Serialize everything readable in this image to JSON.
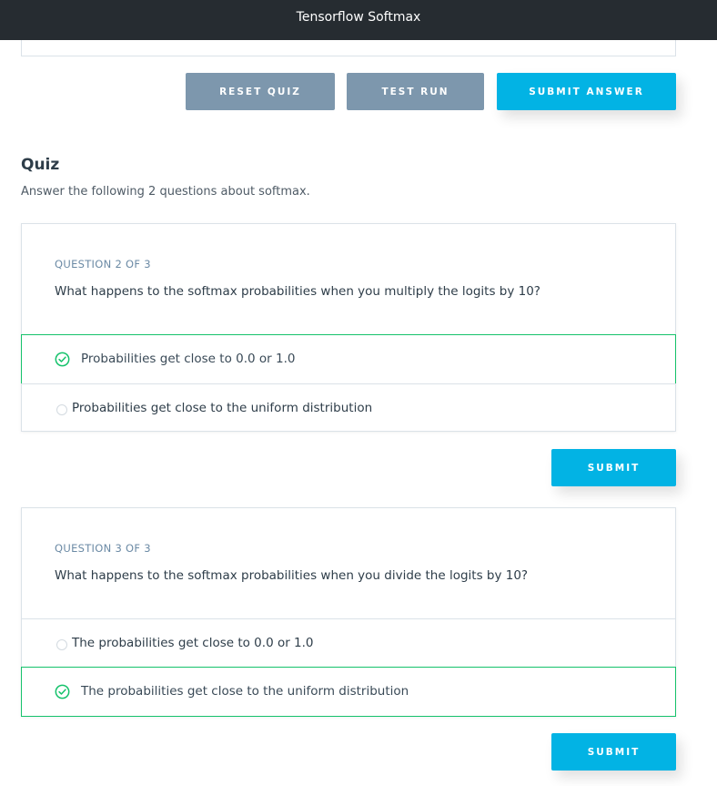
{
  "header": {
    "title": "Tensorflow Softmax"
  },
  "toolbar": {
    "reset_label": "RESET QUIZ",
    "test_label": "TEST RUN",
    "submit_label": "SUBMIT ANSWER"
  },
  "quiz": {
    "title": "Quiz",
    "description": "Answer the following 2 questions about softmax."
  },
  "questions": [
    {
      "number": "QUESTION 2 OF 3",
      "text": "What happens to the softmax probabilities when you multiply the logits by 10?",
      "options": [
        {
          "label": "Probabilities get close to 0.0 or 1.0",
          "selected": true
        },
        {
          "label": "Probabilities get close to the uniform distribution",
          "selected": false
        }
      ],
      "submit_label": "SUBMIT"
    },
    {
      "number": "QUESTION 3 OF 3",
      "text": "What happens to the softmax probabilities when you divide the logits by 10?",
      "options": [
        {
          "label": "The probabilities get close to 0.0 or 1.0",
          "selected": false
        },
        {
          "label": "The probabilities get close to the uniform distribution",
          "selected": true
        }
      ],
      "submit_label": "SUBMIT"
    }
  ],
  "colors": {
    "accent": "#02b3e4",
    "secondary_button": "#7d97ad",
    "correct": "#15c26b",
    "header_bg": "#262c31"
  },
  "icons": {
    "selected": "check-circle-icon",
    "unselected": "radio-circle-icon"
  }
}
